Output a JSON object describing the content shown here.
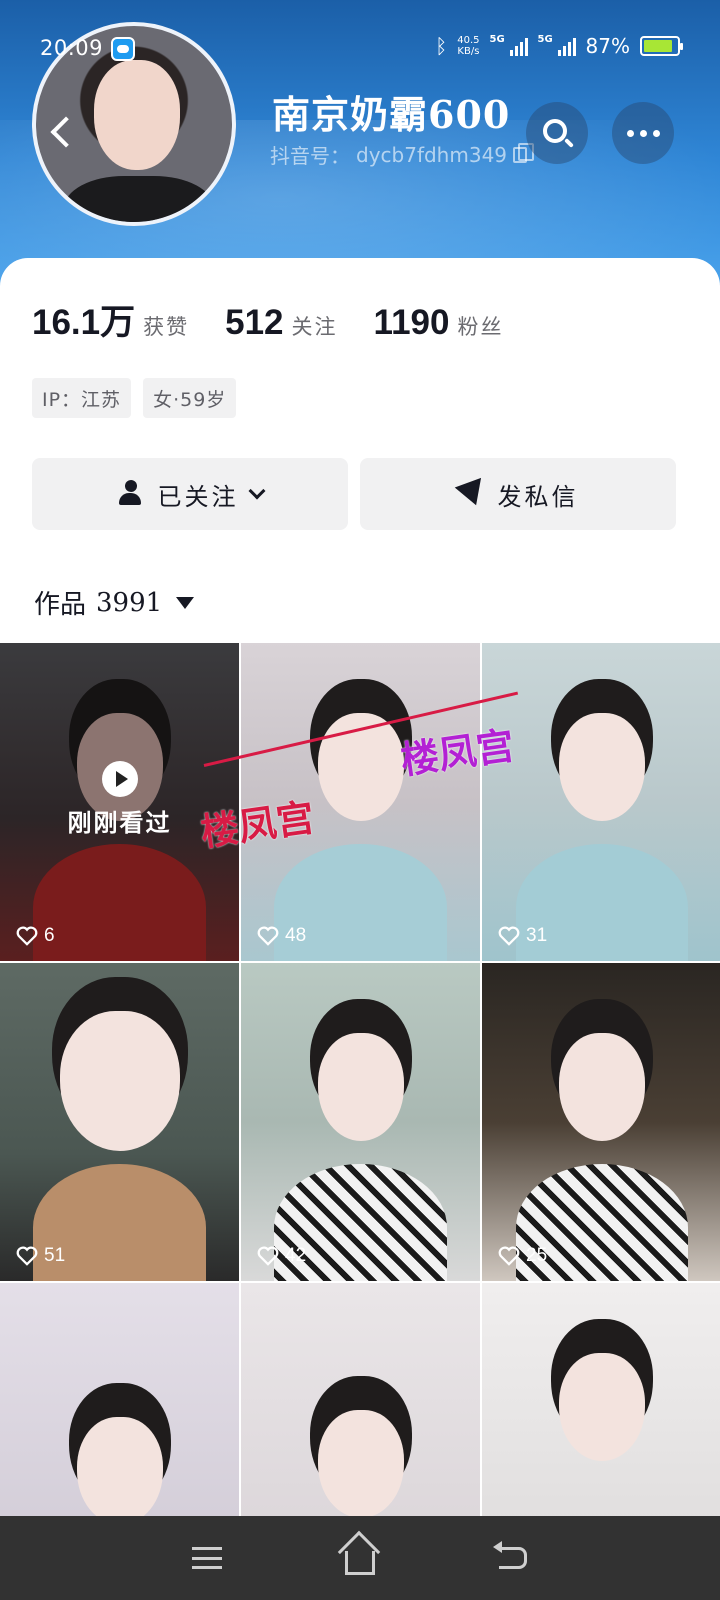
{
  "status_bar": {
    "time": "20:09",
    "net_speed_value": "40.5",
    "net_speed_unit": "KB/s",
    "signal1_label": "5G",
    "signal2_label": "5G",
    "battery_percent": "87%",
    "battery_level": 0.87
  },
  "profile": {
    "nickname": "南京奶霸600",
    "douyin_id_label": "抖音号：",
    "douyin_id": "dycb7fdhm349"
  },
  "stats": [
    {
      "number": "16.1万",
      "label": "获赞"
    },
    {
      "number": "512",
      "label": "关注"
    },
    {
      "number": "1190",
      "label": "粉丝"
    }
  ],
  "tags": [
    "IP：江苏",
    "女·59岁"
  ],
  "actions": {
    "followed_label": "已关注",
    "message_label": "发私信"
  },
  "works": {
    "label": "作品",
    "count": "3991"
  },
  "grid": [
    {
      "likes": "6",
      "overlay": "刚刚看过"
    },
    {
      "likes": "48"
    },
    {
      "likes": "31"
    },
    {
      "likes": "51"
    },
    {
      "likes": "42"
    },
    {
      "likes": "25"
    },
    {
      "likes": ""
    },
    {
      "likes": ""
    },
    {
      "likes": ""
    }
  ],
  "watermark": "楼凤宫",
  "colors": {
    "header_blue": "#2f86d6",
    "battery_green": "#a8e635",
    "watermark_red": "#d81b45",
    "watermark_purple": "#b321d4"
  },
  "icons": {
    "back": "back-chevron-icon",
    "search": "search-icon",
    "more": "more-dots-icon",
    "followed": "user-check-icon",
    "message": "send-icon",
    "like": "heart-icon",
    "nav_menu": "menu-icon",
    "nav_home": "home-icon",
    "nav_back": "back-icon"
  }
}
